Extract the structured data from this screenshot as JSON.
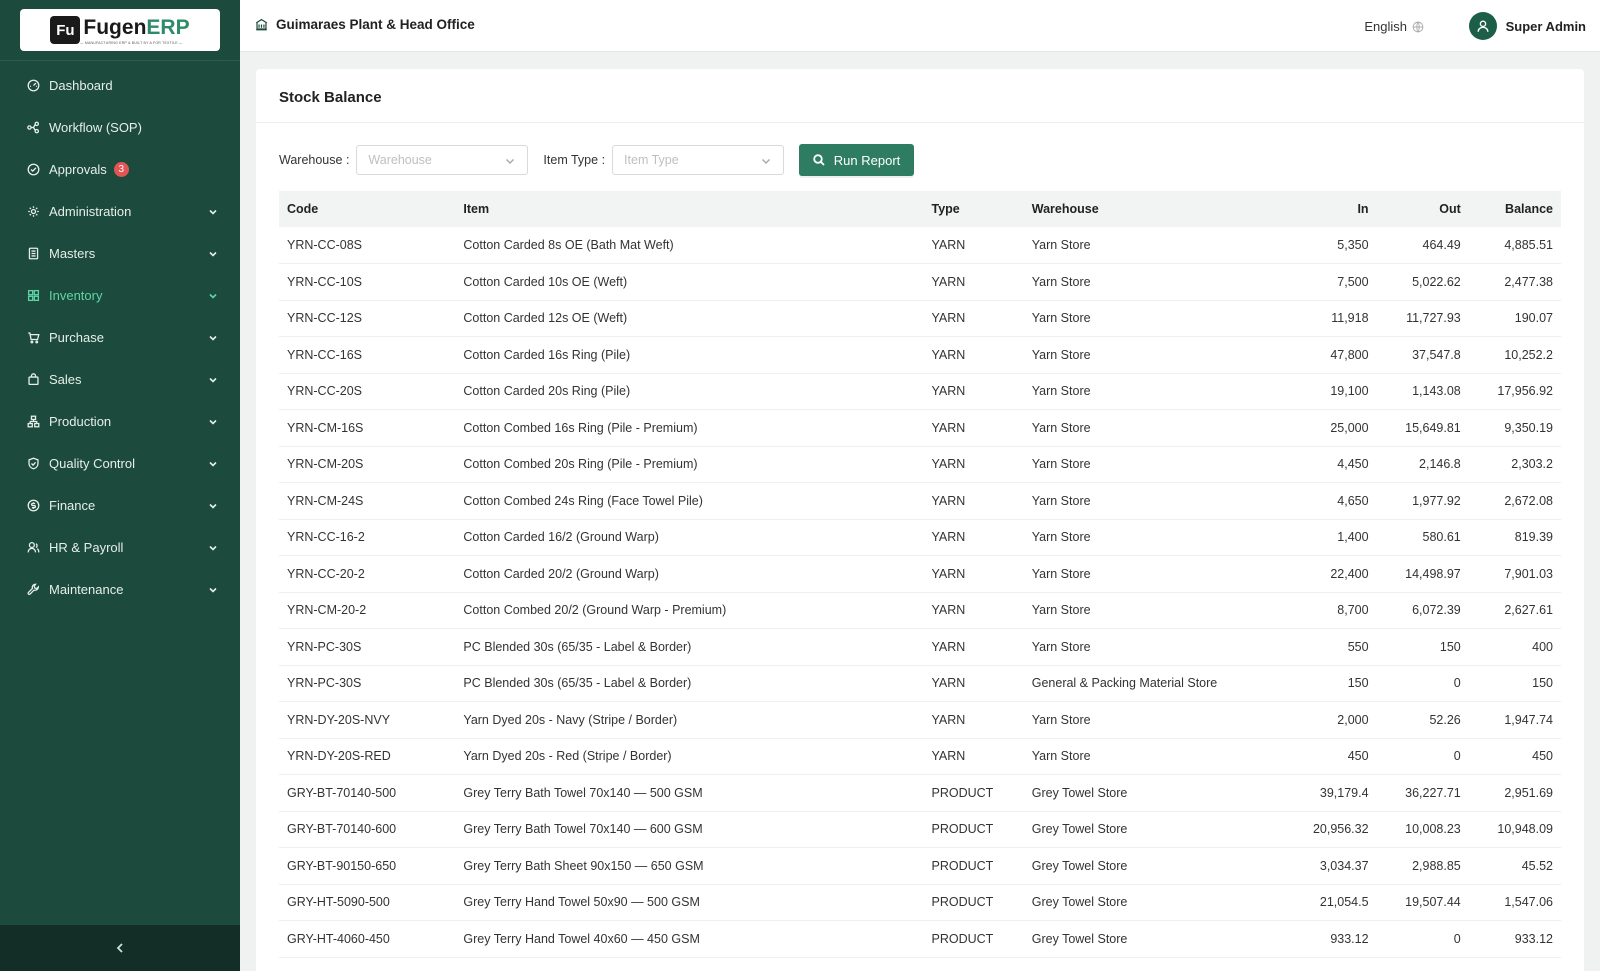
{
  "app": {
    "brand_fugen": "Fugen",
    "brand_erp": "ERP",
    "brand_mark": "Fu",
    "brand_tagline": "— MANUFACTURING ERP & BUILT BY A FOR TEXTILE —"
  },
  "sidebar": {
    "items": [
      {
        "label": "Dashboard",
        "icon": "dashboard-icon"
      },
      {
        "label": "Workflow (SOP)",
        "icon": "workflow-icon"
      },
      {
        "label": "Approvals",
        "icon": "check-circle-icon",
        "badge": "3"
      },
      {
        "label": "Administration",
        "icon": "gear-icon"
      },
      {
        "label": "Masters",
        "icon": "book-icon"
      },
      {
        "label": "Inventory",
        "icon": "grid-icon",
        "active": true
      },
      {
        "label": "Purchase",
        "icon": "cart-icon"
      },
      {
        "label": "Sales",
        "icon": "bag-icon"
      },
      {
        "label": "Production",
        "icon": "cluster-icon"
      },
      {
        "label": "Quality Control",
        "icon": "shield-icon"
      },
      {
        "label": "Finance",
        "icon": "dollar-icon"
      },
      {
        "label": "HR & Payroll",
        "icon": "people-icon"
      },
      {
        "label": "Maintenance",
        "icon": "wrench-icon"
      }
    ],
    "accent": "#5ed6a7",
    "background": "#1c4a3c"
  },
  "header": {
    "organization": "Guimaraes Plant & Head Office",
    "language": "English",
    "user": "Super Admin"
  },
  "page": {
    "title": "Stock Balance",
    "filters": {
      "warehouse_label": "Warehouse",
      "warehouse_placeholder": "Warehouse",
      "item_type_label": "Item Type",
      "item_type_placeholder": "Item Type",
      "run_label": "Run Report"
    },
    "table": {
      "headers": {
        "code": "Code",
        "item": "Item",
        "type": "Type",
        "warehouse": "Warehouse",
        "in": "In",
        "out": "Out",
        "balance": "Balance"
      },
      "rows": [
        [
          "YRN-CC-08S",
          "Cotton Carded 8s OE (Bath Mat Weft)",
          "YARN",
          "Yarn Store",
          "5,350",
          "464.49",
          "4,885.51"
        ],
        [
          "YRN-CC-10S",
          "Cotton Carded 10s OE (Weft)",
          "YARN",
          "Yarn Store",
          "7,500",
          "5,022.62",
          "2,477.38"
        ],
        [
          "YRN-CC-12S",
          "Cotton Carded 12s OE (Weft)",
          "YARN",
          "Yarn Store",
          "11,918",
          "11,727.93",
          "190.07"
        ],
        [
          "YRN-CC-16S",
          "Cotton Carded 16s Ring (Pile)",
          "YARN",
          "Yarn Store",
          "47,800",
          "37,547.8",
          "10,252.2"
        ],
        [
          "YRN-CC-20S",
          "Cotton Carded 20s Ring (Pile)",
          "YARN",
          "Yarn Store",
          "19,100",
          "1,143.08",
          "17,956.92"
        ],
        [
          "YRN-CM-16S",
          "Cotton Combed 16s Ring (Pile - Premium)",
          "YARN",
          "Yarn Store",
          "25,000",
          "15,649.81",
          "9,350.19"
        ],
        [
          "YRN-CM-20S",
          "Cotton Combed 20s Ring (Pile - Premium)",
          "YARN",
          "Yarn Store",
          "4,450",
          "2,146.8",
          "2,303.2"
        ],
        [
          "YRN-CM-24S",
          "Cotton Combed 24s Ring (Face Towel Pile)",
          "YARN",
          "Yarn Store",
          "4,650",
          "1,977.92",
          "2,672.08"
        ],
        [
          "YRN-CC-16-2",
          "Cotton Carded 16/2 (Ground Warp)",
          "YARN",
          "Yarn Store",
          "1,400",
          "580.61",
          "819.39"
        ],
        [
          "YRN-CC-20-2",
          "Cotton Carded 20/2 (Ground Warp)",
          "YARN",
          "Yarn Store",
          "22,400",
          "14,498.97",
          "7,901.03"
        ],
        [
          "YRN-CM-20-2",
          "Cotton Combed 20/2 (Ground Warp - Premium)",
          "YARN",
          "Yarn Store",
          "8,700",
          "6,072.39",
          "2,627.61"
        ],
        [
          "YRN-PC-30S",
          "PC Blended 30s (65/35 - Label & Border)",
          "YARN",
          "Yarn Store",
          "550",
          "150",
          "400"
        ],
        [
          "YRN-PC-30S",
          "PC Blended 30s (65/35 - Label & Border)",
          "YARN",
          "General & Packing Material Store",
          "150",
          "0",
          "150"
        ],
        [
          "YRN-DY-20S-NVY",
          "Yarn Dyed 20s - Navy (Stripe / Border)",
          "YARN",
          "Yarn Store",
          "2,000",
          "52.26",
          "1,947.74"
        ],
        [
          "YRN-DY-20S-RED",
          "Yarn Dyed 20s - Red (Stripe / Border)",
          "YARN",
          "Yarn Store",
          "450",
          "0",
          "450"
        ],
        [
          "GRY-BT-70140-500",
          "Grey Terry Bath Towel 70x140 — 500 GSM",
          "PRODUCT",
          "Grey Towel Store",
          "39,179.4",
          "36,227.71",
          "2,951.69"
        ],
        [
          "GRY-BT-70140-600",
          "Grey Terry Bath Towel 70x140 — 600 GSM",
          "PRODUCT",
          "Grey Towel Store",
          "20,956.32",
          "10,008.23",
          "10,948.09"
        ],
        [
          "GRY-BT-90150-650",
          "Grey Terry Bath Sheet 90x150 — 650 GSM",
          "PRODUCT",
          "Grey Towel Store",
          "3,034.37",
          "2,988.85",
          "45.52"
        ],
        [
          "GRY-HT-5090-500",
          "Grey Terry Hand Towel 50x90 — 500 GSM",
          "PRODUCT",
          "Grey Towel Store",
          "21,054.5",
          "19,507.44",
          "1,547.06"
        ],
        [
          "GRY-HT-4060-450",
          "Grey Terry Hand Towel 40x60 — 450 GSM",
          "PRODUCT",
          "Grey Towel Store",
          "933.12",
          "0",
          "933.12"
        ]
      ]
    }
  }
}
